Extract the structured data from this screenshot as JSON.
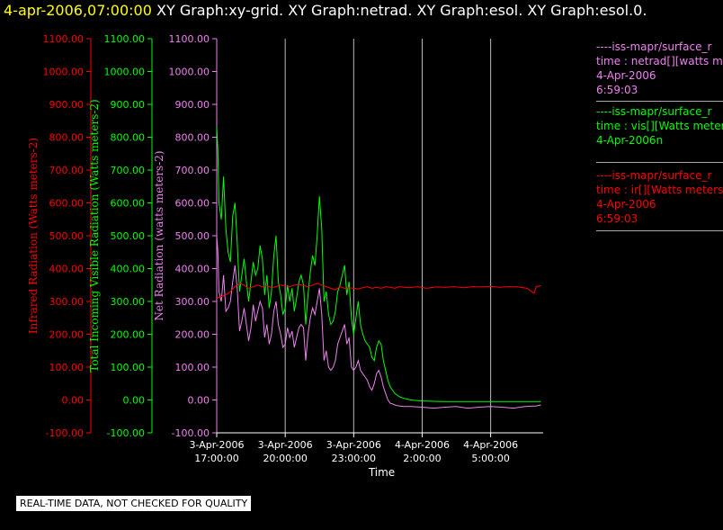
{
  "header": {
    "date": "4-apr-2006,07:00:00",
    "graphs": "XY Graph:xy-grid.  XY Graph:netrad.  XY Graph:esol.  XY Graph:esol.0."
  },
  "legend": [
    {
      "source": "----iss-mapr/surface_r",
      "field": "time : netrad[][watts me",
      "date": "4-Apr-2006",
      "time": "6:59:03",
      "color": "#ee82ee"
    },
    {
      "source": "----iss-mapr/surface_r",
      "field": "time : vis[][Watts meter",
      "date": "4-Apr-2006n",
      "time": "",
      "color": "#00ff00"
    },
    {
      "source": "----iss-mapr/surface_r",
      "field": "time : ir[][Watts meters",
      "date": "4-Apr-2006",
      "time": "6:59:03",
      "color": "#ff0000"
    }
  ],
  "notice": "REAL-TIME DATA, NOT CHECKED FOR QUALITY",
  "chart_data": {
    "type": "line",
    "xlabel": "Time",
    "x_ticks": [
      {
        "hour": 17,
        "line1": "3-Apr-2006",
        "line2": "17:00:00"
      },
      {
        "hour": 20,
        "line1": "3-Apr-2006",
        "line2": "20:00:00"
      },
      {
        "hour": 23,
        "line1": "3-Apr-2006",
        "line2": "23:00:00"
      },
      {
        "hour": 26,
        "line1": "4-Apr-2006",
        "line2": "2:00:00"
      },
      {
        "hour": 29,
        "line1": "4-Apr-2006",
        "line2": "5:00:00"
      }
    ],
    "xlim_hours_since_3apr": [
      17,
      31.3
    ],
    "ylim": [
      -100,
      1100
    ],
    "y_ticks": [
      "-100.00",
      "0.00",
      "100.00",
      "200.00",
      "300.00",
      "400.00",
      "500.00",
      "600.00",
      "700.00",
      "800.00",
      "900.00",
      "1000.00",
      "1100.00"
    ],
    "axes": [
      {
        "label": "Infrared Radiation (Watts meters-2)",
        "color": "#ff0000"
      },
      {
        "label": "Total Incoming Visible Radiation (Watts meters-2)",
        "color": "#00ff00"
      },
      {
        "label": "Net Radiation (watts meters-2)",
        "color": "#ee82ee"
      }
    ],
    "series": [
      {
        "name": "vis",
        "color": "#00ff00",
        "x": [
          17.0,
          17.05,
          17.1,
          17.2,
          17.3,
          17.4,
          17.5,
          17.6,
          17.7,
          17.8,
          17.9,
          18.0,
          18.1,
          18.2,
          18.3,
          18.4,
          18.5,
          18.6,
          18.7,
          18.8,
          18.9,
          19.0,
          19.1,
          19.2,
          19.3,
          19.4,
          19.5,
          19.6,
          19.7,
          19.8,
          19.9,
          20.0,
          20.1,
          20.2,
          20.3,
          20.4,
          20.5,
          20.6,
          20.7,
          20.8,
          20.9,
          21.0,
          21.1,
          21.2,
          21.3,
          21.4,
          21.5,
          21.6,
          21.7,
          21.8,
          21.9,
          22.0,
          22.1,
          22.2,
          22.3,
          22.4,
          22.5,
          22.6,
          22.7,
          22.8,
          22.9,
          23.0,
          23.1,
          23.2,
          23.3,
          23.4,
          23.5,
          23.6,
          23.7,
          23.8,
          23.9,
          24.0,
          24.1,
          24.2,
          24.3,
          24.4,
          24.5,
          24.6,
          24.7,
          24.8,
          24.9,
          25.0,
          25.2,
          25.5,
          26.0,
          26.5,
          27.0,
          27.5,
          28.0,
          28.5,
          29.0,
          29.5,
          30.0,
          30.5,
          31.0,
          31.2
        ],
        "values": [
          830,
          760,
          600,
          550,
          680,
          520,
          450,
          420,
          560,
          600,
          480,
          330,
          380,
          430,
          360,
          300,
          360,
          420,
          380,
          400,
          470,
          430,
          320,
          380,
          280,
          330,
          440,
          500,
          360,
          320,
          260,
          280,
          350,
          300,
          340,
          270,
          310,
          360,
          380,
          350,
          230,
          320,
          390,
          440,
          410,
          500,
          620,
          520,
          300,
          330,
          260,
          230,
          240,
          270,
          330,
          350,
          380,
          410,
          320,
          360,
          250,
          200,
          250,
          300,
          230,
          200,
          180,
          170,
          160,
          130,
          120,
          160,
          180,
          170,
          120,
          90,
          60,
          40,
          30,
          20,
          15,
          10,
          5,
          0,
          -3,
          -4,
          -5,
          -5,
          -5,
          -5,
          -5,
          -5,
          -5,
          -5,
          -5,
          -5
        ]
      },
      {
        "name": "netrad",
        "color": "#ee82ee",
        "x": [
          17.0,
          17.05,
          17.1,
          17.2,
          17.3,
          17.4,
          17.5,
          17.6,
          17.7,
          17.8,
          17.9,
          18.0,
          18.1,
          18.2,
          18.3,
          18.4,
          18.5,
          18.6,
          18.7,
          18.8,
          18.9,
          19.0,
          19.1,
          19.2,
          19.3,
          19.4,
          19.5,
          19.6,
          19.7,
          19.8,
          19.9,
          20.0,
          20.1,
          20.2,
          20.3,
          20.4,
          20.5,
          20.6,
          20.7,
          20.8,
          20.9,
          21.0,
          21.1,
          21.2,
          21.3,
          21.4,
          21.5,
          21.6,
          21.7,
          21.8,
          21.9,
          22.0,
          22.1,
          22.2,
          22.3,
          22.4,
          22.5,
          22.6,
          22.7,
          22.8,
          22.9,
          23.0,
          23.1,
          23.2,
          23.3,
          23.4,
          23.5,
          23.6,
          23.7,
          23.8,
          23.9,
          24.0,
          24.1,
          24.2,
          24.3,
          24.4,
          24.5,
          24.6,
          24.7,
          24.8,
          24.9,
          25.0,
          25.2,
          25.5,
          26.0,
          26.5,
          27.0,
          27.5,
          28.0,
          28.5,
          29.0,
          29.5,
          30.0,
          30.5,
          31.0,
          31.2
        ],
        "values": [
          500,
          450,
          330,
          300,
          380,
          270,
          280,
          300,
          360,
          410,
          340,
          210,
          240,
          280,
          230,
          180,
          220,
          290,
          240,
          270,
          300,
          280,
          190,
          230,
          170,
          200,
          270,
          300,
          230,
          200,
          160,
          170,
          220,
          190,
          210,
          160,
          190,
          220,
          230,
          220,
          120,
          200,
          250,
          280,
          260,
          300,
          340,
          260,
          120,
          150,
          100,
          90,
          100,
          120,
          170,
          190,
          210,
          230,
          170,
          190,
          100,
          90,
          100,
          120,
          90,
          80,
          70,
          60,
          40,
          30,
          50,
          80,
          90,
          70,
          40,
          20,
          0,
          -10,
          -12,
          -15,
          -17,
          -18,
          -20,
          -20,
          -22,
          -25,
          -22,
          -20,
          -25,
          -22,
          -20,
          -22,
          -25,
          -20,
          -18,
          -15
        ]
      },
      {
        "name": "ir",
        "color": "#ff0000",
        "x": [
          17.0,
          17.2,
          17.4,
          17.6,
          17.8,
          18.0,
          18.2,
          18.4,
          18.6,
          18.8,
          19.0,
          19.2,
          19.4,
          19.6,
          19.8,
          20.0,
          20.2,
          20.4,
          20.6,
          20.8,
          21.0,
          21.2,
          21.4,
          21.6,
          21.8,
          22.0,
          22.2,
          22.4,
          22.6,
          22.8,
          23.0,
          23.2,
          23.4,
          23.6,
          23.8,
          24.0,
          24.2,
          24.4,
          24.6,
          24.8,
          25.0,
          25.4,
          25.8,
          26.2,
          26.6,
          27.0,
          27.4,
          27.8,
          28.2,
          28.6,
          29.0,
          29.4,
          29.8,
          30.2,
          30.6,
          30.9,
          31.0,
          31.2
        ],
        "values": [
          310,
          315,
          320,
          330,
          345,
          355,
          350,
          340,
          345,
          350,
          345,
          348,
          342,
          345,
          350,
          347,
          345,
          350,
          352,
          348,
          345,
          350,
          355,
          350,
          345,
          340,
          335,
          345,
          340,
          342,
          340,
          338,
          342,
          345,
          340,
          343,
          340,
          345,
          343,
          340,
          345,
          342,
          345,
          340,
          344,
          343,
          345,
          342,
          345,
          344,
          346,
          343,
          345,
          344,
          340,
          325,
          345,
          348
        ]
      }
    ]
  }
}
